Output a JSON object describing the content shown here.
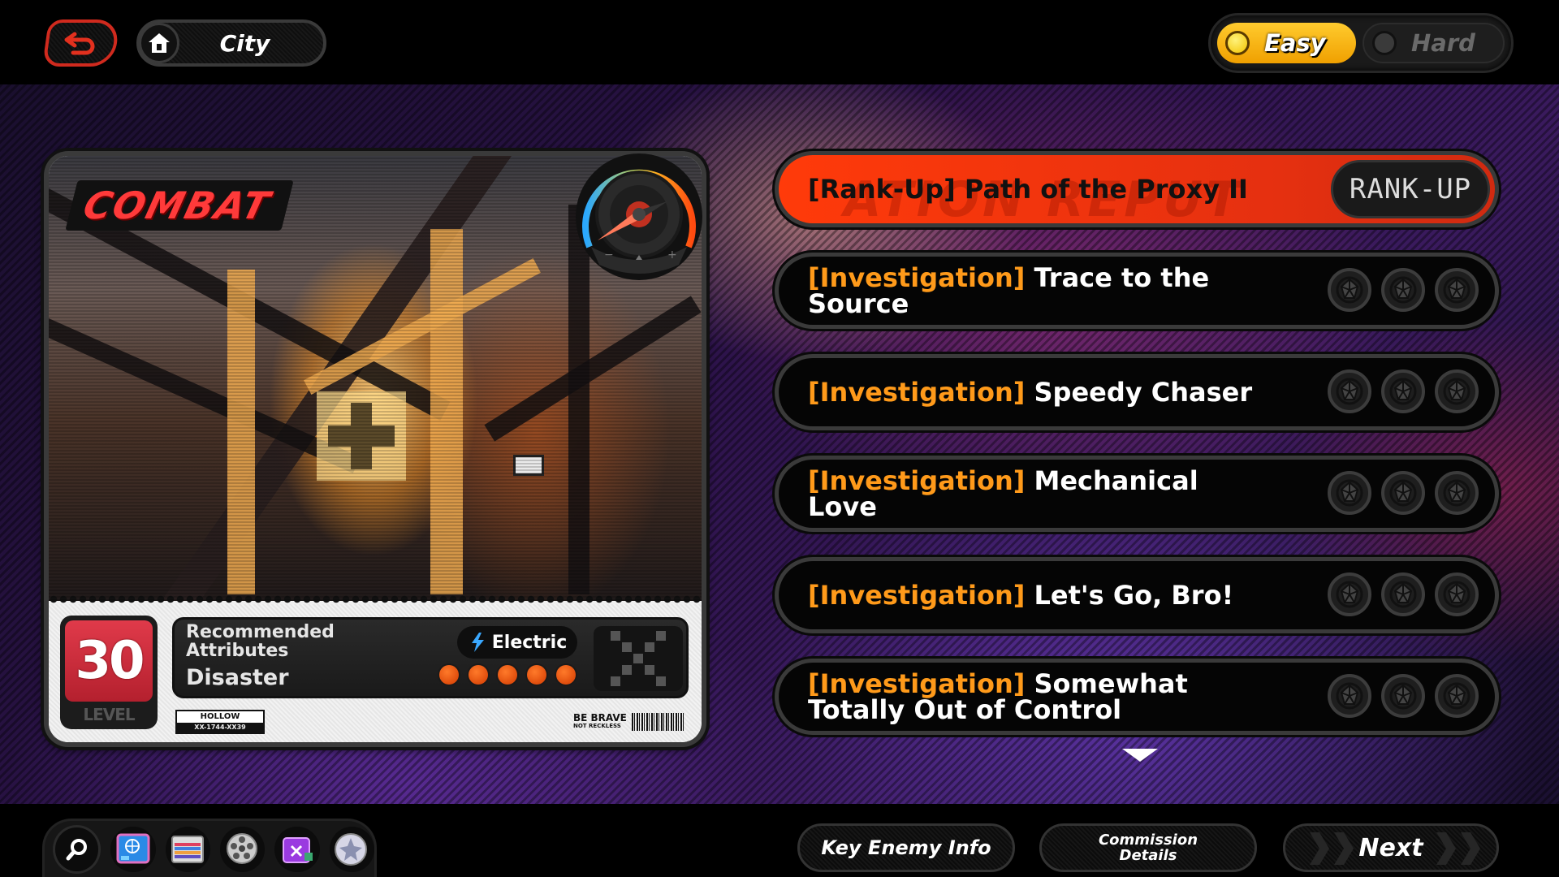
{
  "header": {
    "back_icon": "return-arrow-icon",
    "home_icon": "home-icon",
    "location": "City"
  },
  "difficulty": {
    "options": [
      {
        "label": "Easy",
        "selected": true
      },
      {
        "label": "Hard",
        "selected": false
      }
    ],
    "active_color": "#f5b400"
  },
  "card": {
    "type_label": "COMBAT",
    "level": "30",
    "level_label": "LEVEL",
    "recommended_label": "Recommended Attributes",
    "recommended_value": "Disaster",
    "element": "Electric",
    "element_icon": "lightning-icon",
    "difficulty_dots": 5,
    "plate_top": "HOLLOW",
    "plate_bottom": "XX-1744-XX39",
    "slogan_main": "BE BRAVE",
    "slogan_sub": "NOT RECKLESS",
    "gauge_icon": "speedometer-gauge-icon"
  },
  "missions": [
    {
      "tag": "[Rank-Up]",
      "title": "Path of the Proxy II",
      "watermark": "ATION REPUT",
      "button": "RANK-UP",
      "selected": true
    },
    {
      "tag": "[Investigation]",
      "title": "Trace to the Source",
      "rewards": 3
    },
    {
      "tag": "[Investigation]",
      "title": "Speedy Chaser",
      "rewards": 3
    },
    {
      "tag": "[Investigation]",
      "title": "Mechanical Love",
      "rewards": 3
    },
    {
      "tag": "[Investigation]",
      "title": "Let's Go, Bro!",
      "rewards": 3
    },
    {
      "tag": "[Investigation]",
      "title": "Somewhat Totally Out of Control",
      "rewards": 3
    }
  ],
  "toolbar": {
    "tools": [
      "search-icon",
      "map-tablet-icon",
      "film-clapper-icon",
      "film-reel-icon",
      "purple-box-icon",
      "star-badge-icon"
    ]
  },
  "actions": {
    "key_enemy": "Key Enemy Info",
    "commission": "Commission Details",
    "next": "Next"
  },
  "colors": {
    "rank_up": "#ff3a0a",
    "investigation_tag": "#ff9a1a",
    "combat_red": "#ff3a3a",
    "electric_blue": "#3aa8ff"
  }
}
